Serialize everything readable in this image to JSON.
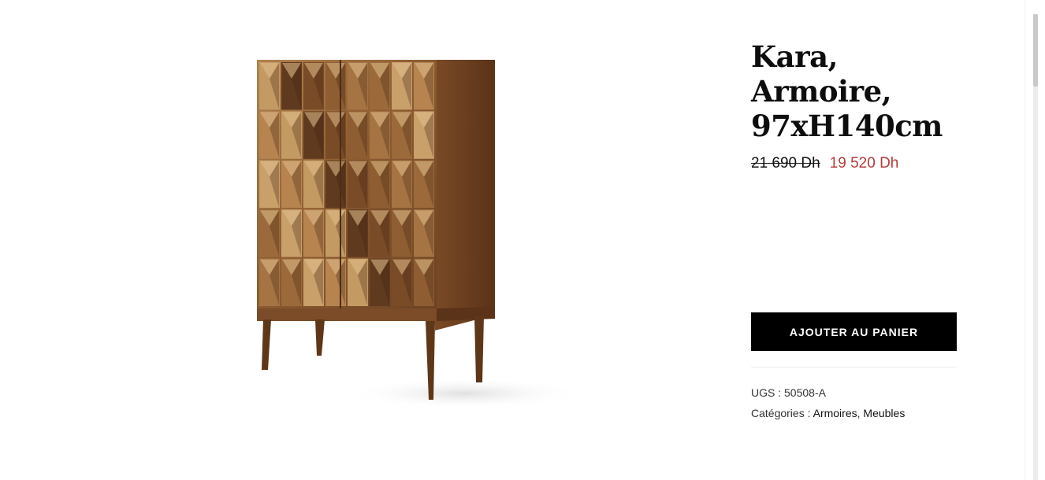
{
  "product": {
    "title_line1": "Kara,",
    "title_line2": "Armoire,",
    "title_line3": "97xH140cm",
    "price_old": "21 690 Dh",
    "price_new": "19 520 Dh",
    "add_to_cart_label": "AJOUTER AU PANIER",
    "sku_label": "UGS : ",
    "sku_value": "50508-A",
    "categories_label": "Catégories : ",
    "categories": [
      "Armoires",
      "Meubles"
    ],
    "categories_separator": ", "
  },
  "image": {
    "alt": "Kara, Armoire, 97xH140cm",
    "wood_color": "#8a5a32"
  },
  "colors": {
    "accent_price": "#b53a3a",
    "button_bg": "#000000",
    "button_text": "#ffffff"
  }
}
